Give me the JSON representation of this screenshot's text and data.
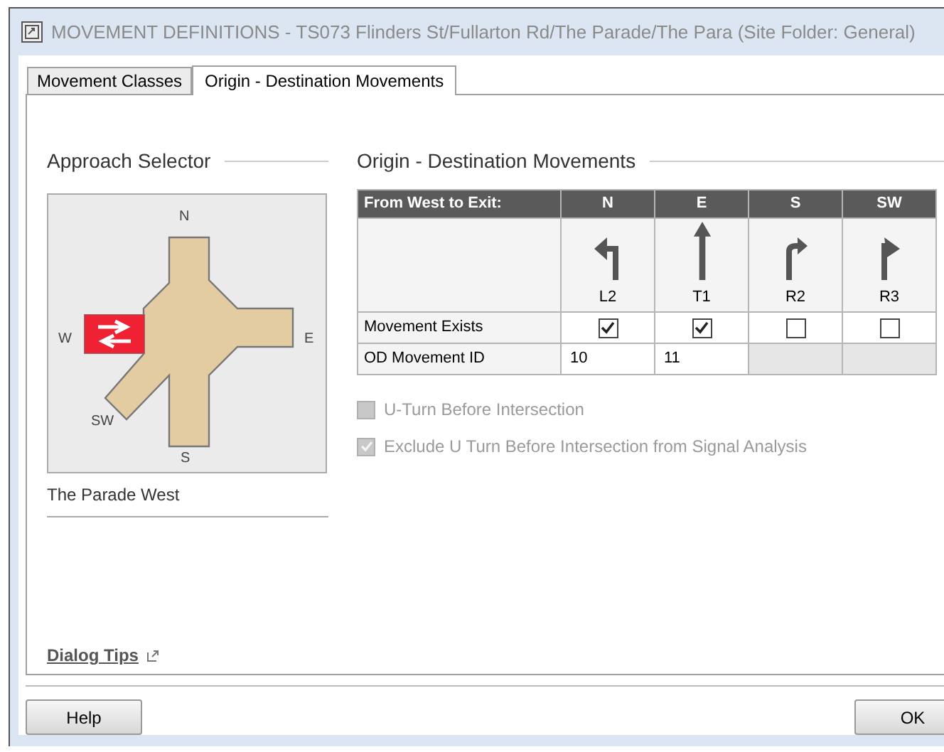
{
  "window": {
    "title": "MOVEMENT DEFINITIONS - TS073 Flinders St/Fullarton Rd/The Parade/The Para (Site Folder: General)"
  },
  "tabs": [
    {
      "label": "Movement Classes",
      "selected": false
    },
    {
      "label": "Origin - Destination Movements",
      "selected": true
    }
  ],
  "approach_selector": {
    "title": "Approach Selector",
    "legs": [
      {
        "label": "N"
      },
      {
        "label": "E"
      },
      {
        "label": "S"
      },
      {
        "label": "SW"
      },
      {
        "label": "W",
        "selected": true
      }
    ],
    "selected_approach": "The Parade West"
  },
  "od_movements": {
    "title": "Origin - Destination Movements",
    "corner_header": "From West to Exit:",
    "row_labels": [
      "Movement Exists",
      "OD Movement ID"
    ],
    "columns": [
      {
        "exit": "N",
        "kind": "left",
        "code": "L2",
        "exists": true,
        "id": "10"
      },
      {
        "exit": "E",
        "kind": "through",
        "code": "T1",
        "exists": true,
        "id": "11"
      },
      {
        "exit": "S",
        "kind": "right",
        "code": "R2",
        "exists": false
      },
      {
        "exit": "SW",
        "kind": "sharp-right",
        "code": "R3",
        "exists": false
      }
    ],
    "options": [
      {
        "label": "U-Turn Before Intersection",
        "checked": false,
        "disabled": true
      },
      {
        "label": "Exclude U Turn Before Intersection from Signal Analysis",
        "checked": true,
        "disabled": true
      }
    ]
  },
  "dialog_tips": "Dialog Tips",
  "buttons": [
    {
      "label": "Help"
    },
    {
      "label": "OK"
    }
  ]
}
